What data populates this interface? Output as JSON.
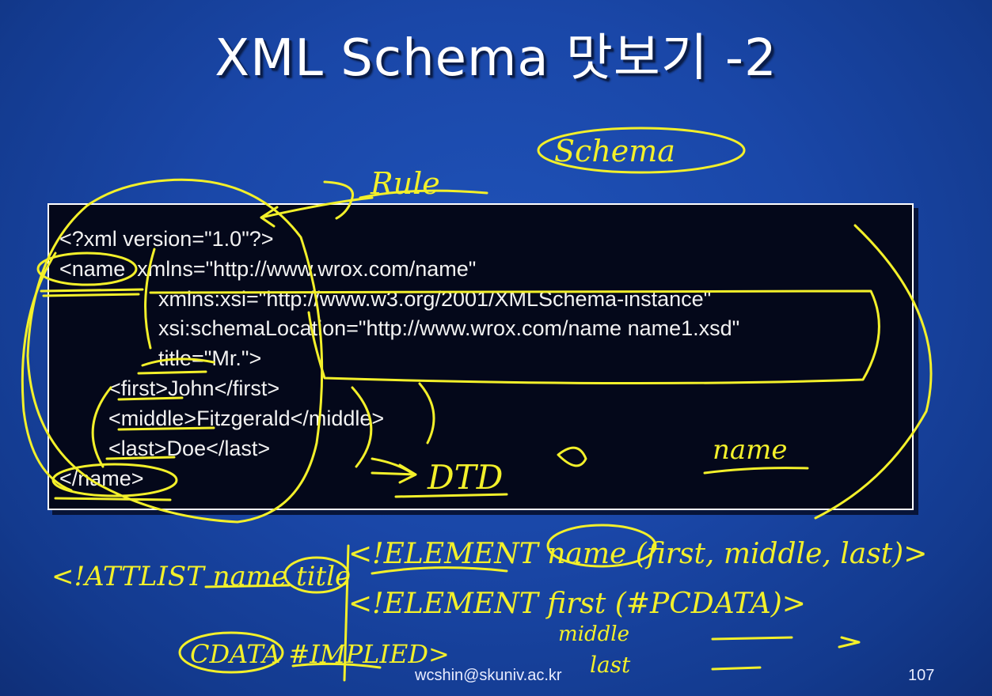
{
  "slide": {
    "title": "XML Schema 맛보기 -2",
    "code_lines": [
      "<?xml version=\"1.0\"?>",
      "<name  xmlns=\"http://www.wrox.com/name\"",
      "xmlns:xsi=\"http://www.w3.org/2001/XMLSchema-instance\"",
      "xsi:schemaLocation=\"http://www.wrox.com/name name1.xsd\"",
      "title=\"Mr.\">",
      "<first>John</first>",
      "<middle>Fitzgerald</middle>",
      "<last>Doe</last>",
      "</name>"
    ],
    "footer_email": "wcshin@skuniv.ac.kr",
    "page_number": "107"
  },
  "annotations": {
    "ink_color": "#f3f02a",
    "schema_word": "Schema",
    "rule_word": "Rule",
    "dtd_word": "DTD",
    "name_word": "name",
    "element_decl_1": "<!ELEMENT name (first, middle, last)>",
    "element_decl_2": "<!ELEMENT first (#PCDATA)>",
    "attlist_decl": "<!ATTLIST name title",
    "cdata_implied": "CDATA #IMPLIED>",
    "middle_word": "middle",
    "last_word": "last"
  }
}
